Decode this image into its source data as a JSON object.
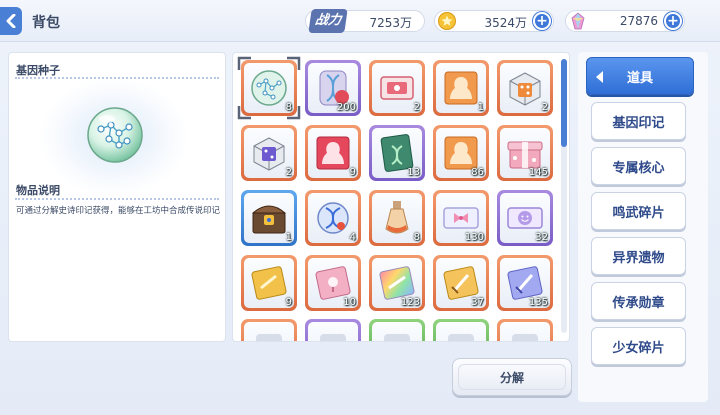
{
  "header": {
    "title": "背包",
    "power_label": "战力",
    "power_value": "7253万",
    "coins": "3524万",
    "gems": "27876"
  },
  "detail": {
    "item_name": "基因种子",
    "desc_title": "物品说明",
    "description": "可通过分解史诗印记获得，能够在工坊中合成传说印记"
  },
  "items": [
    {
      "icon": "gene-seed-orb-icon",
      "rarity": "orange",
      "count": "8",
      "selected": true
    },
    {
      "icon": "dna-capsule-icon",
      "rarity": "purple",
      "count": "200"
    },
    {
      "icon": "red-ticket-icon",
      "rarity": "orange",
      "count": "2"
    },
    {
      "icon": "orange-character-card-icon",
      "rarity": "orange",
      "count": "1"
    },
    {
      "icon": "orange-dice-box-icon",
      "rarity": "orange",
      "count": "2"
    },
    {
      "icon": "purple-dice-box-icon",
      "rarity": "orange",
      "count": "2"
    },
    {
      "icon": "red-character-card-icon",
      "rarity": "orange",
      "count": "9"
    },
    {
      "icon": "green-gene-card-icon",
      "rarity": "purple",
      "count": "13"
    },
    {
      "icon": "orange-character-card-icon",
      "rarity": "orange",
      "count": "86"
    },
    {
      "icon": "pink-gift-box-icon",
      "rarity": "orange",
      "count": "145"
    },
    {
      "icon": "treasure-chest-icon",
      "rarity": "blue",
      "count": "1"
    },
    {
      "icon": "dna-orb-icon",
      "rarity": "orange",
      "count": "4"
    },
    {
      "icon": "potion-bottle-icon",
      "rarity": "orange",
      "count": "8"
    },
    {
      "icon": "ribbon-ticket-icon",
      "rarity": "orange",
      "count": "130"
    },
    {
      "icon": "smile-ticket-icon",
      "rarity": "purple",
      "count": "32"
    },
    {
      "icon": "gold-card-icon",
      "rarity": "orange",
      "count": "9"
    },
    {
      "icon": "pink-card-icon",
      "rarity": "orange",
      "count": "10"
    },
    {
      "icon": "rainbow-card-icon",
      "rarity": "orange",
      "count": "123"
    },
    {
      "icon": "gold-sword-card-icon",
      "rarity": "orange",
      "count": "37"
    },
    {
      "icon": "blue-sword-card-icon",
      "rarity": "orange",
      "count": "135"
    },
    {
      "icon": "partial-item-icon",
      "rarity": "orange",
      "count": ""
    },
    {
      "icon": "partial-item-icon",
      "rarity": "purple",
      "count": ""
    },
    {
      "icon": "partial-item-icon",
      "rarity": "green",
      "count": ""
    },
    {
      "icon": "partial-item-icon",
      "rarity": "green",
      "count": ""
    },
    {
      "icon": "partial-item-icon",
      "rarity": "orange",
      "count": ""
    }
  ],
  "colors": {
    "orange": "#dc6a3f",
    "purple": "#7a5cc7",
    "blue": "#2f73c8",
    "green": "#4fa34a",
    "accent": "#2f6ed6"
  },
  "actions": {
    "decompose": "分解"
  },
  "categories": [
    {
      "label": "道具",
      "active": true
    },
    {
      "label": "基因印记"
    },
    {
      "label": "专属核心"
    },
    {
      "label": "鸣武碎片"
    },
    {
      "label": "异界遗物"
    },
    {
      "label": "传承勋章"
    },
    {
      "label": "少女碎片"
    }
  ]
}
